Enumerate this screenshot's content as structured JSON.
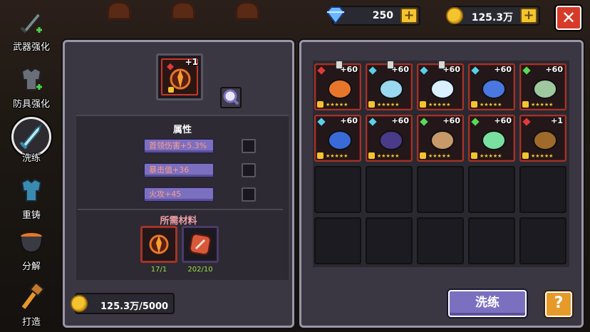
{
  "sidebar": {
    "items": [
      {
        "label": "武器强化",
        "icon": "sword-upgrade-icon"
      },
      {
        "label": "防具强化",
        "icon": "armor-upgrade-icon"
      },
      {
        "label": "洗练",
        "icon": "sword-refine-icon",
        "active": true
      },
      {
        "label": "重铸",
        "icon": "armor-recast-icon"
      },
      {
        "label": "分解",
        "icon": "cauldron-icon"
      },
      {
        "label": "打造",
        "icon": "hammer-icon"
      }
    ]
  },
  "topbar": {
    "gems": "250",
    "gold": "125.3万",
    "close_label": "✕"
  },
  "selected_weapon": {
    "level": "+1",
    "icon": "flame-blade-icon"
  },
  "attributes": {
    "title": "属性",
    "stats": [
      {
        "label": "首领伤害+5.3%"
      },
      {
        "label": "暴击值+36"
      },
      {
        "label": "火攻+45"
      }
    ]
  },
  "materials": {
    "title": "所需材料",
    "items": [
      {
        "count": "17/1",
        "icon": "flame-blade-icon"
      },
      {
        "count": "202/10",
        "icon": "refine-stone-icon"
      }
    ]
  },
  "cost": {
    "value": "125.3万/5000"
  },
  "inventory": [
    {
      "level": "+60",
      "gem": "#e03a3a",
      "icon": "pumpkin-icon",
      "pinned": true,
      "stars": "★★★★★"
    },
    {
      "level": "+60",
      "gem": "#5ad0e8",
      "icon": "ice-shuriken-icon",
      "pinned": true,
      "stars": "★★★★★"
    },
    {
      "level": "+60",
      "gem": "#5ad0e8",
      "icon": "snowball-icon",
      "pinned": true,
      "stars": "★★★★★"
    },
    {
      "level": "+60",
      "gem": "#5ad0e8",
      "icon": "ice-spear-icon",
      "pinned": false,
      "stars": "★★★★★"
    },
    {
      "level": "+60",
      "gem": "#5ad85a",
      "icon": "syringe-icon",
      "pinned": false,
      "stars": "★★★★★"
    },
    {
      "level": "+60",
      "gem": "#5ad0e8",
      "icon": "blue-fish-gun-icon",
      "pinned": false,
      "stars": "★★★★★"
    },
    {
      "level": "+60",
      "gem": "#5ad0e8",
      "icon": "dark-staff-icon",
      "pinned": false,
      "stars": "★★★★★"
    },
    {
      "level": "+60",
      "gem": "#5ad85a",
      "icon": "totem-icon",
      "pinned": false,
      "stars": "★★★★★"
    },
    {
      "level": "+60",
      "gem": "#5ad85a",
      "icon": "green-blade-icon",
      "pinned": false,
      "stars": "★★★★★"
    },
    {
      "level": "+1",
      "gem": "#e03a3a",
      "icon": "flame-blade-icon",
      "pinned": false,
      "stars": "★★★★★"
    }
  ],
  "buttons": {
    "refine_label": "洗练",
    "help_label": "?"
  },
  "colors": {
    "gold": "#f4c430",
    "accent_purple": "#7b70c0",
    "red_frame": "#a23429",
    "close_red": "#d83a2a"
  }
}
